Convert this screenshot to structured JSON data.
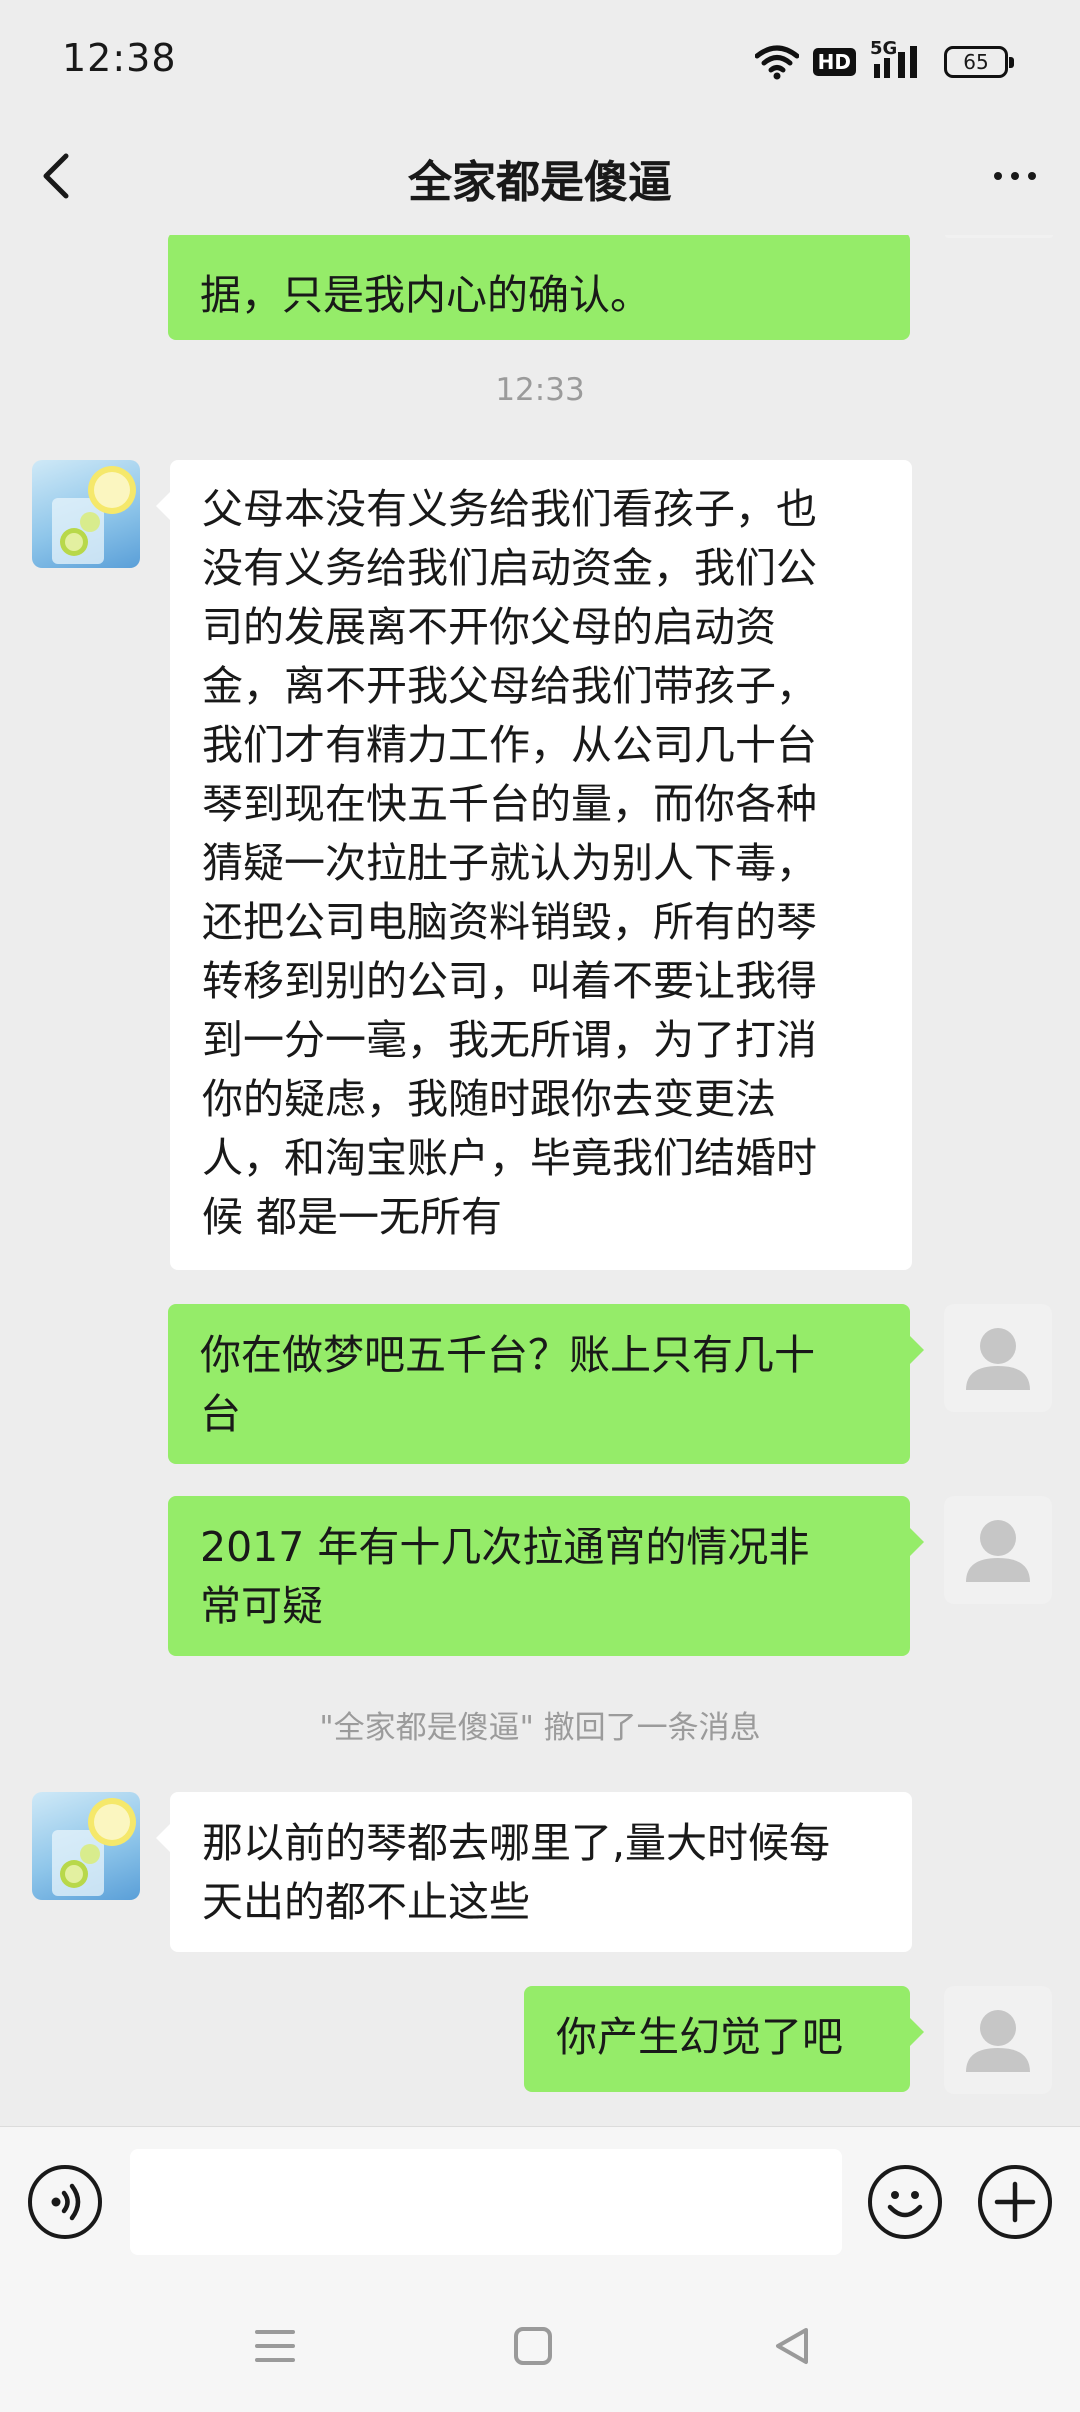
{
  "status_bar": {
    "time": "12:38",
    "network": "5G",
    "hd": "HD",
    "battery": "65"
  },
  "header": {
    "title": "全家都是傻逼"
  },
  "messages": [
    {
      "side": "me",
      "lines": [
        "据，只是我内心的确认。"
      ]
    },
    {
      "type": "time",
      "text": "12:33"
    },
    {
      "side": "them",
      "lines": [
        "父母本没有义务给我们看孩子，也",
        "没有义务给我们启动资金，我们公",
        "司的发展离不开你父母的启动资",
        "金，离不开我父母给我们带孩子，",
        "我们才有精力工作，从公司几十台",
        "琴到现在快五千台的量，而你各种",
        "猜疑一次拉肚子就认为别人下毒，",
        "还把公司电脑资料销毁，所有的琴",
        "转移到别的公司，叫着不要让我得",
        "到一分一毫，我无所谓，为了打消",
        "你的疑虑，我随时跟你去变更法",
        "人，和淘宝账户，毕竟我们结婚时",
        "候 都是一无所有"
      ]
    },
    {
      "side": "me",
      "lines": [
        "你在做梦吧五千台？账上只有几十",
        "台"
      ]
    },
    {
      "side": "me",
      "lines": [
        "2017 年有十几次拉通宵的情况非",
        "常可疑"
      ]
    },
    {
      "type": "recall",
      "text": "\"全家都是傻逼\" 撤回了一条消息"
    },
    {
      "side": "them",
      "lines": [
        "那以前的琴都去哪里了,量大时候每",
        "天出的都不止这些"
      ]
    },
    {
      "side": "me",
      "lines": [
        "你产生幻觉了吧"
      ]
    }
  ],
  "icons": {
    "back": "back-arrow-icon",
    "more": "more-dots-icon",
    "voice": "voice-icon",
    "emoji": "emoji-icon",
    "plus": "plus-icon",
    "menu": "menu-icon",
    "home": "home-icon",
    "back_nav": "back-triangle-icon"
  },
  "colors": {
    "my_bubble": "#95ec69",
    "their_bubble": "#ffffff",
    "background": "#ededed"
  }
}
